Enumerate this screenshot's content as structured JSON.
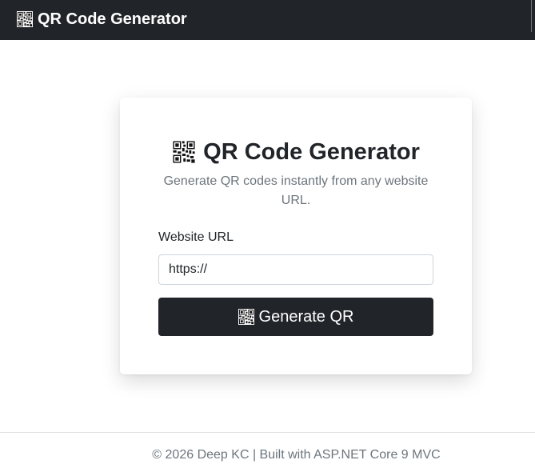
{
  "navbar": {
    "brand": "QR Code Generator",
    "brand_icon": "qr-code-icon"
  },
  "card": {
    "title": "QR Code Generator",
    "title_icon": "qr-code-icon",
    "subtitle": "Generate QR codes instantly from any website URL.",
    "url_label": "Website URL",
    "url_value": "https://",
    "generate_label": "Generate QR",
    "generate_icon": "qr-code-icon"
  },
  "footer": {
    "text": "© 2026 Deep KC | Built with ASP.NET Core 9 MVC"
  },
  "colors": {
    "dark": "#212529",
    "muted": "#6c757d",
    "white": "#ffffff",
    "input_border": "#ced4da"
  }
}
